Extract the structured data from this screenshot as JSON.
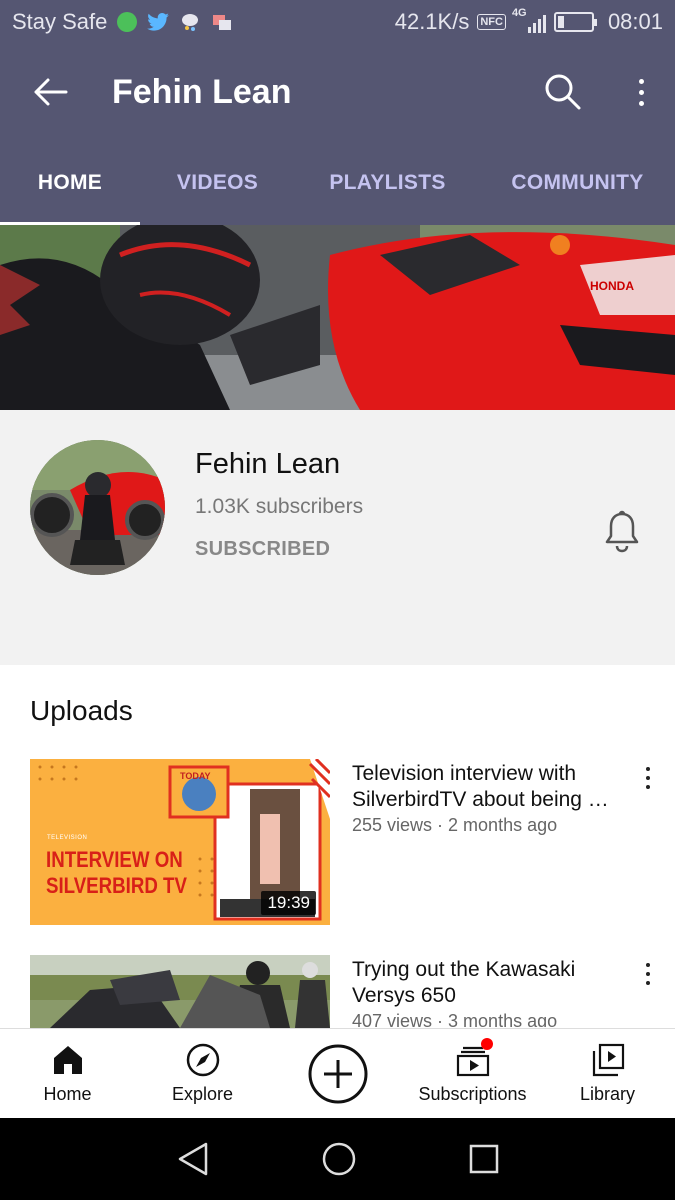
{
  "status_bar": {
    "left_text": "Stay Safe",
    "net_speed": "42.1K/s",
    "nfc": "NFC",
    "network": "4G",
    "time": "08:01"
  },
  "header": {
    "title": "Fehin Lean",
    "icons": [
      "back-arrow-icon",
      "search-icon",
      "more-vert-icon"
    ]
  },
  "tabs": [
    {
      "label": "HOME",
      "active": true
    },
    {
      "label": "VIDEOS",
      "active": false
    },
    {
      "label": "PLAYLISTS",
      "active": false
    },
    {
      "label": "COMMUNITY",
      "active": false
    }
  ],
  "channel": {
    "name": "Fehin Lean",
    "subscribers": "1.03K subscribers",
    "subscribed_label": "SUBSCRIBED"
  },
  "uploads": {
    "title": "Uploads",
    "videos": [
      {
        "title": "Television interview with SilverbirdTV about being …",
        "meta": "255 views · 2 months ago",
        "duration": "19:39",
        "thumb_heading_small": "TELEVISION",
        "thumb_heading_line1": "INTERVIEW ON",
        "thumb_heading_line2": "SILVERBIRD TV",
        "thumb_badge": "TODAY"
      },
      {
        "title": "Trying out the Kawasaki Versys 650",
        "meta": "407 views · 3 months ago"
      }
    ]
  },
  "bottom_nav": [
    {
      "label": "Home",
      "icon": "home-icon"
    },
    {
      "label": "Explore",
      "icon": "compass-icon"
    },
    {
      "label": "",
      "icon": "create-plus-icon"
    },
    {
      "label": "Subscriptions",
      "icon": "subscriptions-icon"
    },
    {
      "label": "Library",
      "icon": "library-icon"
    }
  ],
  "colors": {
    "header_bg": "#555672",
    "tab_inactive": "#c5c3f0",
    "accent_red": "#ff0000"
  }
}
